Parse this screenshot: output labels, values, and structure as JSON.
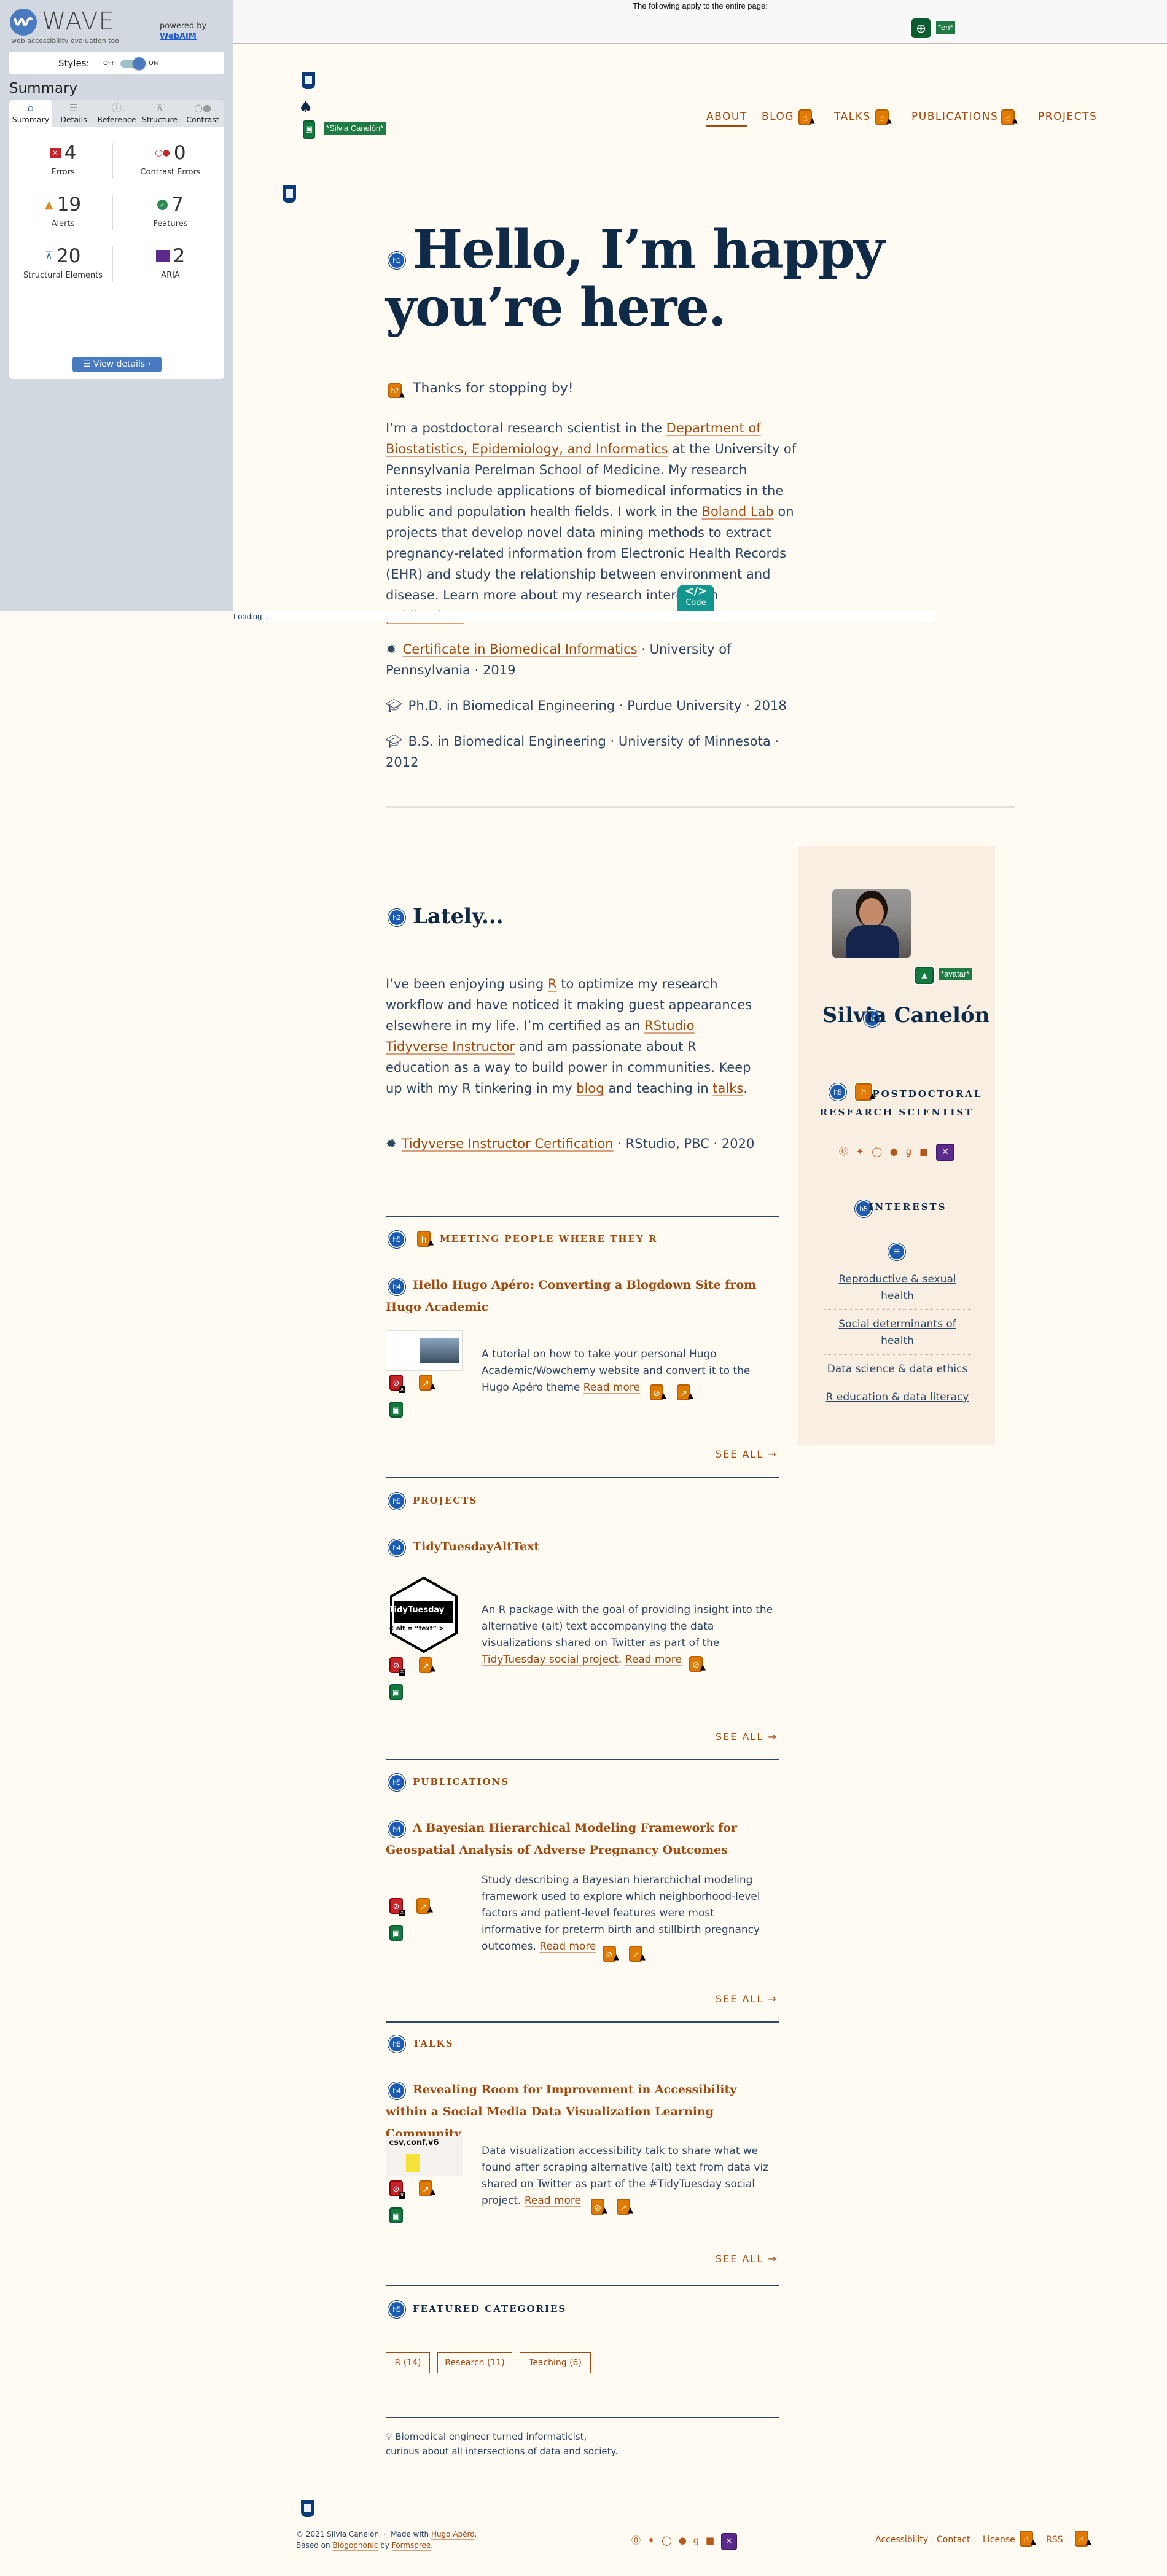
{
  "wave": {
    "title": "WAVE",
    "tagline": "web accessibility evaluation tool",
    "powered_by": "powered by",
    "powered_by_link": "WebAIM",
    "styles_label": "Styles:",
    "styles_off": "OFF",
    "styles_on": "ON",
    "styles_enabled": true,
    "summary_heading": "Summary",
    "tabs": [
      {
        "label": "Summary",
        "icon": "home-icon",
        "active": true
      },
      {
        "label": "Details",
        "icon": "list-icon",
        "active": false
      },
      {
        "label": "Reference",
        "icon": "info-icon",
        "active": false
      },
      {
        "label": "Structure",
        "icon": "sitemap-icon",
        "active": false
      },
      {
        "label": "Contrast",
        "icon": "contrast-icon",
        "active": false
      }
    ],
    "stats": [
      {
        "label": "Errors",
        "value": "4",
        "icon": "error-icon",
        "color": "#c6232b"
      },
      {
        "label": "Contrast Errors",
        "value": "0",
        "icon": "contrast-error-icon",
        "color": "#c6232b"
      },
      {
        "label": "Alerts",
        "value": "19",
        "icon": "alert-icon",
        "color": "#e08a1e"
      },
      {
        "label": "Features",
        "value": "7",
        "icon": "feature-icon",
        "color": "#2e8a55"
      },
      {
        "label": "Structural Elements",
        "value": "20",
        "icon": "structure-icon",
        "color": "#3e6fb8"
      },
      {
        "label": "ARIA",
        "value": "2",
        "icon": "aria-icon",
        "color": "#5b2a8c"
      }
    ],
    "view_details": "View details ›",
    "page_notice": "The following apply to the entire page:",
    "lang_label": "*en*",
    "loading": "Loading...",
    "code_badge": "Code",
    "labels": {
      "site_title": "*Silvia Canelón*",
      "avatar": "*avatar*"
    }
  },
  "nav": {
    "items": [
      {
        "label": "ABOUT",
        "active": true
      },
      {
        "label": "BLOG",
        "active": false
      },
      {
        "label": "TALKS",
        "active": false
      },
      {
        "label": "PUBLICATIONS",
        "active": false
      },
      {
        "label": "PROJECTS",
        "active": false
      }
    ]
  },
  "hero": {
    "title": "Hello, I’m happy you’re here.",
    "subtitle": "Thanks for stopping by!",
    "bio": {
      "p1": "I’m a postdoctoral research scientist in the ",
      "link1": "Department of Biostatistics, Epidemiology, and Informatics",
      "p2": " at the University of Pennsylvania Perelman School of Medicine. My research interests include applications of biomedical informatics in the public and population health fields. I work in the ",
      "link2": "Boland Lab",
      "p3": " on projects that develop novel data mining methods to extract pregnancy-related information from Electronic Health Records (EHR) and study the relationship between environment and disease. Learn more about my research interests in ",
      "link3": "publications",
      "p4": "."
    }
  },
  "education": [
    {
      "icon": "certificate-icon",
      "link": "Certificate in Biomedical Informatics",
      "text": " · University of Pennsylvania · 2019"
    },
    {
      "icon": "graduation-cap-icon",
      "link": "",
      "text": "Ph.D. in Biomedical Engineering · Purdue University · 2018"
    },
    {
      "icon": "graduation-cap-icon",
      "link": "",
      "text": "B.S. in Biomedical Engineering · University of Minnesota · 2012"
    }
  ],
  "profile": {
    "name": "Silvia Canelón",
    "role": "POSTDOCTORAL RESEARCH SCIENTIST",
    "social": [
      "accessibility-icon",
      "twitter-icon",
      "github-icon",
      "orcid-icon",
      "google-scholar-icon",
      "linkedin-icon"
    ],
    "interests_title": "INTERESTS",
    "interests": [
      "Reproductive & sexual health",
      "Social determinants of health",
      "Data science & data ethics",
      "R education & data literacy"
    ]
  },
  "lately": {
    "title": "Lately...",
    "t1": "I’ve been enjoying using ",
    "l1": "R",
    "t2": " to optimize my research workflow and have noticed it making guest appearances elsewhere in my life. I’m certified as an ",
    "l2": "RStudio Tidyverse Instructor",
    "t3": " and am passionate about R education as a way to build power in communities. Keep up with my R tinkering in my ",
    "l3": "blog",
    "t4": " and teaching in ",
    "l4": "talks",
    "t5": ".",
    "cert_link": "Tidyverse Instructor Certification",
    "cert_text": " · RStudio, PBC · 2020"
  },
  "sections": [
    {
      "heading": "MEETING PEOPLE WHERE THEY R",
      "title": "Hello Hugo Apéro: Converting a Blogdown Site from Hugo Academic",
      "desc": "A tutorial on how to take your personal Hugo Academic/Wowchemy website and convert it to the Hugo Apéro theme ",
      "desc_link": "",
      "read_more": "Read more",
      "see_all": "SEE ALL →"
    },
    {
      "heading": "PROJECTS",
      "title": "TidyTuesdayAltText",
      "desc": "An R package with the goal of providing insight into the alternative (alt) text accompanying the data visualizations shared on Twitter as part of the ",
      "desc_link": "TidyTuesday social project",
      "read_more": "Read more",
      "see_all": "SEE ALL →",
      "thumb_title": "TidyTuesday",
      "thumb_sub": "< alt = “text” >"
    },
    {
      "heading": "PUBLICATIONS",
      "title": "A Bayesian Hierarchical Modeling Framework for Geospatial Analysis of Adverse Pregnancy Outcomes",
      "desc": "Study describing a Bayesian hierarchichal modeling framework used to explore which neighborhood-level factors and patient-level features were most informative for preterm birth and stillbirth pregnancy outcomes. ",
      "desc_link": "",
      "read_more": "Read more",
      "see_all": "SEE ALL →"
    },
    {
      "heading": "TALKS",
      "title": "Revealing Room for Improvement in Accessibility within a Social Media Data Visualization Learning Community",
      "desc": "Data visualization accessibility talk to share what we found after scraping alternative (alt) text from data viz shared on Twitter as part of the #TidyTuesday social project. ",
      "desc_link": "",
      "read_more": "Read more",
      "see_all": "SEE ALL →",
      "thumb_title": "csv,conf,v6"
    }
  ],
  "categories": {
    "heading": "FEATURED CATEGORIES",
    "items": [
      "R (14)",
      "Research (11)",
      "Teaching (6)"
    ]
  },
  "tagline": {
    "line1": "Biomedical engineer turned informaticist,",
    "line2": "curious about all intersections of data and society."
  },
  "footer": {
    "copyright": "© 2021 Silvia Canelón",
    "made_with": "Made with ",
    "made_with_link": "Hugo Apéro",
    "based_on": "Based on ",
    "based_on_link": "Blogophonic",
    "by": " by ",
    "by_link": "Formspree",
    "links": [
      "Accessibility",
      "Contact",
      "License",
      "RSS"
    ]
  }
}
